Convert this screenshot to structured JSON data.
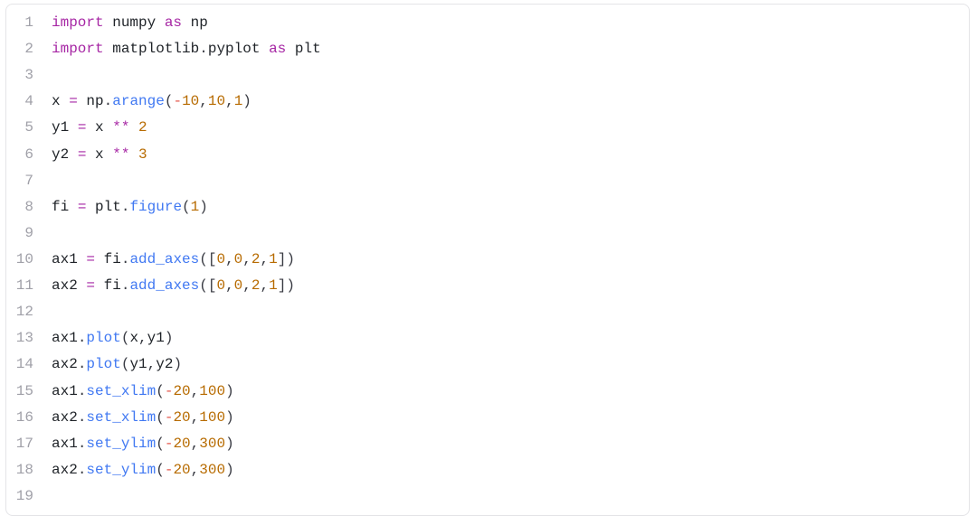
{
  "code": {
    "lines": [
      {
        "num": "1",
        "tokens": [
          {
            "cls": "kw",
            "t": "import"
          },
          {
            "cls": "tok",
            "t": " numpy "
          },
          {
            "cls": "kw",
            "t": "as"
          },
          {
            "cls": "tok",
            "t": " np"
          }
        ]
      },
      {
        "num": "2",
        "tokens": [
          {
            "cls": "kw",
            "t": "import"
          },
          {
            "cls": "tok",
            "t": " matplotlib"
          },
          {
            "cls": "punct",
            "t": "."
          },
          {
            "cls": "tok",
            "t": "pyplot "
          },
          {
            "cls": "kw",
            "t": "as"
          },
          {
            "cls": "tok",
            "t": " plt"
          }
        ]
      },
      {
        "num": "3",
        "tokens": []
      },
      {
        "num": "4",
        "tokens": [
          {
            "cls": "tok",
            "t": "x "
          },
          {
            "cls": "op",
            "t": "="
          },
          {
            "cls": "tok",
            "t": " np"
          },
          {
            "cls": "punct",
            "t": "."
          },
          {
            "cls": "func",
            "t": "arange"
          },
          {
            "cls": "punct",
            "t": "("
          },
          {
            "cls": "opred",
            "t": "-"
          },
          {
            "cls": "num",
            "t": "10"
          },
          {
            "cls": "punct",
            "t": ","
          },
          {
            "cls": "num",
            "t": "10"
          },
          {
            "cls": "punct",
            "t": ","
          },
          {
            "cls": "num",
            "t": "1"
          },
          {
            "cls": "punct",
            "t": ")"
          }
        ]
      },
      {
        "num": "5",
        "tokens": [
          {
            "cls": "tok",
            "t": "y1 "
          },
          {
            "cls": "op",
            "t": "="
          },
          {
            "cls": "tok",
            "t": " x "
          },
          {
            "cls": "op",
            "t": "**"
          },
          {
            "cls": "tok",
            "t": " "
          },
          {
            "cls": "num",
            "t": "2"
          }
        ]
      },
      {
        "num": "6",
        "tokens": [
          {
            "cls": "tok",
            "t": "y2 "
          },
          {
            "cls": "op",
            "t": "="
          },
          {
            "cls": "tok",
            "t": " x "
          },
          {
            "cls": "op",
            "t": "**"
          },
          {
            "cls": "tok",
            "t": " "
          },
          {
            "cls": "num",
            "t": "3"
          }
        ]
      },
      {
        "num": "7",
        "tokens": []
      },
      {
        "num": "8",
        "tokens": [
          {
            "cls": "tok",
            "t": "fi "
          },
          {
            "cls": "op",
            "t": "="
          },
          {
            "cls": "tok",
            "t": " plt"
          },
          {
            "cls": "punct",
            "t": "."
          },
          {
            "cls": "func",
            "t": "figure"
          },
          {
            "cls": "punct",
            "t": "("
          },
          {
            "cls": "num",
            "t": "1"
          },
          {
            "cls": "punct",
            "t": ")"
          }
        ]
      },
      {
        "num": "9",
        "tokens": []
      },
      {
        "num": "10",
        "tokens": [
          {
            "cls": "tok",
            "t": "ax1 "
          },
          {
            "cls": "op",
            "t": "="
          },
          {
            "cls": "tok",
            "t": " fi"
          },
          {
            "cls": "punct",
            "t": "."
          },
          {
            "cls": "func",
            "t": "add_axes"
          },
          {
            "cls": "punct",
            "t": "(["
          },
          {
            "cls": "num",
            "t": "0"
          },
          {
            "cls": "punct",
            "t": ","
          },
          {
            "cls": "num",
            "t": "0"
          },
          {
            "cls": "punct",
            "t": ","
          },
          {
            "cls": "num",
            "t": "2"
          },
          {
            "cls": "punct",
            "t": ","
          },
          {
            "cls": "num",
            "t": "1"
          },
          {
            "cls": "punct",
            "t": "])"
          }
        ]
      },
      {
        "num": "11",
        "tokens": [
          {
            "cls": "tok",
            "t": "ax2 "
          },
          {
            "cls": "op",
            "t": "="
          },
          {
            "cls": "tok",
            "t": " fi"
          },
          {
            "cls": "punct",
            "t": "."
          },
          {
            "cls": "func",
            "t": "add_axes"
          },
          {
            "cls": "punct",
            "t": "(["
          },
          {
            "cls": "num",
            "t": "0"
          },
          {
            "cls": "punct",
            "t": ","
          },
          {
            "cls": "num",
            "t": "0"
          },
          {
            "cls": "punct",
            "t": ","
          },
          {
            "cls": "num",
            "t": "2"
          },
          {
            "cls": "punct",
            "t": ","
          },
          {
            "cls": "num",
            "t": "1"
          },
          {
            "cls": "punct",
            "t": "])"
          }
        ]
      },
      {
        "num": "12",
        "tokens": []
      },
      {
        "num": "13",
        "tokens": [
          {
            "cls": "tok",
            "t": "ax1"
          },
          {
            "cls": "punct",
            "t": "."
          },
          {
            "cls": "func",
            "t": "plot"
          },
          {
            "cls": "punct",
            "t": "("
          },
          {
            "cls": "tok",
            "t": "x"
          },
          {
            "cls": "punct",
            "t": ","
          },
          {
            "cls": "tok",
            "t": "y1"
          },
          {
            "cls": "punct",
            "t": ")"
          }
        ]
      },
      {
        "num": "14",
        "tokens": [
          {
            "cls": "tok",
            "t": "ax2"
          },
          {
            "cls": "punct",
            "t": "."
          },
          {
            "cls": "func",
            "t": "plot"
          },
          {
            "cls": "punct",
            "t": "("
          },
          {
            "cls": "tok",
            "t": "y1"
          },
          {
            "cls": "punct",
            "t": ","
          },
          {
            "cls": "tok",
            "t": "y2"
          },
          {
            "cls": "punct",
            "t": ")"
          }
        ]
      },
      {
        "num": "15",
        "tokens": [
          {
            "cls": "tok",
            "t": "ax1"
          },
          {
            "cls": "punct",
            "t": "."
          },
          {
            "cls": "func",
            "t": "set_xlim"
          },
          {
            "cls": "punct",
            "t": "("
          },
          {
            "cls": "opred",
            "t": "-"
          },
          {
            "cls": "num",
            "t": "20"
          },
          {
            "cls": "punct",
            "t": ","
          },
          {
            "cls": "num",
            "t": "100"
          },
          {
            "cls": "punct",
            "t": ")"
          }
        ]
      },
      {
        "num": "16",
        "tokens": [
          {
            "cls": "tok",
            "t": "ax2"
          },
          {
            "cls": "punct",
            "t": "."
          },
          {
            "cls": "func",
            "t": "set_xlim"
          },
          {
            "cls": "punct",
            "t": "("
          },
          {
            "cls": "opred",
            "t": "-"
          },
          {
            "cls": "num",
            "t": "20"
          },
          {
            "cls": "punct",
            "t": ","
          },
          {
            "cls": "num",
            "t": "100"
          },
          {
            "cls": "punct",
            "t": ")"
          }
        ]
      },
      {
        "num": "17",
        "tokens": [
          {
            "cls": "tok",
            "t": "ax1"
          },
          {
            "cls": "punct",
            "t": "."
          },
          {
            "cls": "func",
            "t": "set_ylim"
          },
          {
            "cls": "punct",
            "t": "("
          },
          {
            "cls": "opred",
            "t": "-"
          },
          {
            "cls": "num",
            "t": "20"
          },
          {
            "cls": "punct",
            "t": ","
          },
          {
            "cls": "num",
            "t": "300"
          },
          {
            "cls": "punct",
            "t": ")"
          }
        ]
      },
      {
        "num": "18",
        "tokens": [
          {
            "cls": "tok",
            "t": "ax2"
          },
          {
            "cls": "punct",
            "t": "."
          },
          {
            "cls": "func",
            "t": "set_ylim"
          },
          {
            "cls": "punct",
            "t": "("
          },
          {
            "cls": "opred",
            "t": "-"
          },
          {
            "cls": "num",
            "t": "20"
          },
          {
            "cls": "punct",
            "t": ","
          },
          {
            "cls": "num",
            "t": "300"
          },
          {
            "cls": "punct",
            "t": ")"
          }
        ]
      },
      {
        "num": "19",
        "tokens": []
      }
    ]
  }
}
